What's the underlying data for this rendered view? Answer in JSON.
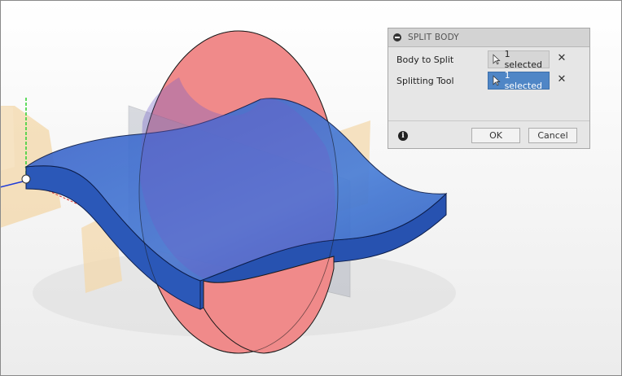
{
  "dialog": {
    "title": "SPLIT BODY",
    "rows": [
      {
        "label": "Body to Split",
        "value": "1 selected",
        "active": false
      },
      {
        "label": "Splitting Tool",
        "value": "1 selected",
        "active": true
      }
    ],
    "info_icon": "info-icon",
    "ok_label": "OK",
    "cancel_label": "Cancel",
    "clear_glyph": "✕"
  },
  "colors": {
    "body_blue": "#3f6fcf",
    "split_plane_red": "#f08a8a",
    "construction_orange": "#f3d7a8",
    "selected_blue": "#4f86c6"
  },
  "icons": [
    "minimize-icon",
    "cursor-arrow-icon",
    "close-icon",
    "info-icon"
  ]
}
